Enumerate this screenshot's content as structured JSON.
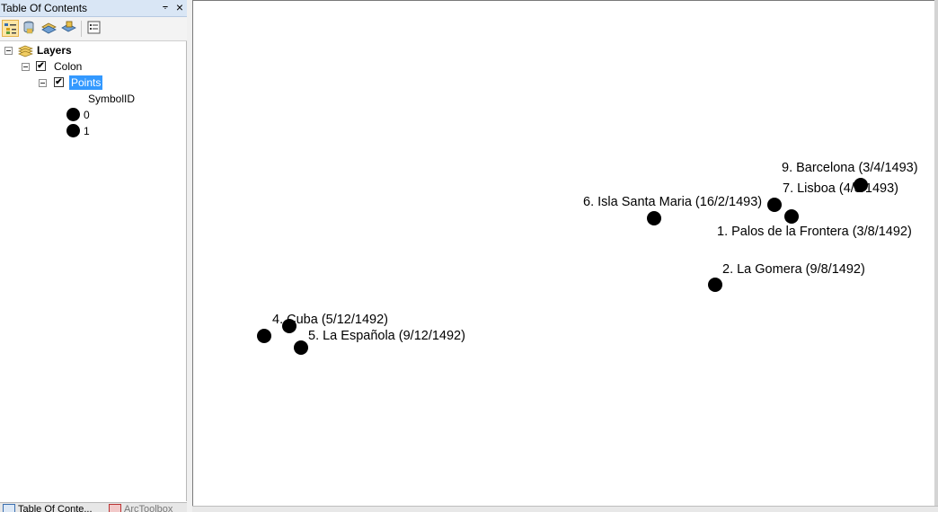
{
  "toc": {
    "title": "Table Of Contents",
    "pin_glyph": "⨪",
    "close_glyph": "×",
    "toolbar": [
      "list-by-drawing-order-icon",
      "list-by-source-icon",
      "list-by-visibility-icon",
      "list-by-selection-icon",
      "options-icon"
    ],
    "tree": {
      "root_label": "Layers",
      "frame_label": "Colon",
      "frame_checked": "✔",
      "layer_label": "Points",
      "layer_checked": "✔",
      "field_label": "SymbolID",
      "symbols": [
        {
          "value": "0"
        },
        {
          "value": "1"
        }
      ]
    },
    "tabs": [
      {
        "label": "Table Of Conte..."
      },
      {
        "label": "ArcToolbox"
      }
    ]
  },
  "map": {
    "points": [
      {
        "label": "9. Barcelona (3/4/1493)"
      },
      {
        "label": "7. Lisboa (4/3/1493)"
      },
      {
        "label": "6. Isla Santa Maria (16/2/1493)"
      },
      {
        "label": "1. Palos de la Frontera (3/8/1492)"
      },
      {
        "label": "2. La Gomera (9/8/1492)"
      },
      {
        "label": "4. Cuba (5/12/1492)"
      },
      {
        "label": "5. La Española (9/12/1492)"
      }
    ]
  }
}
